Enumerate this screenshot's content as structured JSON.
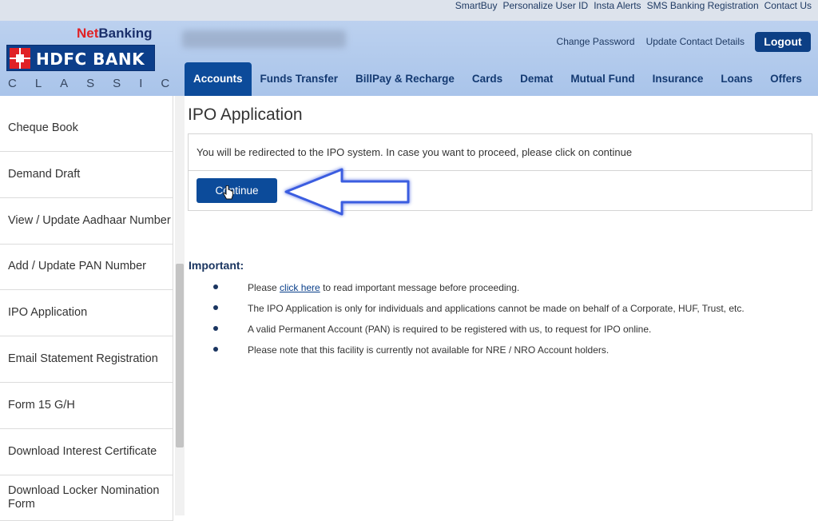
{
  "utility_links": [
    "SmartBuy",
    "Personalize User ID",
    "Insta Alerts",
    "SMS Banking Registration",
    "Contact Us"
  ],
  "logo": {
    "net": "Net",
    "banking": "Banking",
    "bank_name": "HDFC BANK",
    "edition": "CLASSIC"
  },
  "header_links": {
    "change_password": "Change Password",
    "update_contact": "Update Contact Details"
  },
  "logout_label": "Logout",
  "nav_tabs": [
    {
      "label": "Accounts"
    },
    {
      "label": "Funds Transfer"
    },
    {
      "label": "BillPay & Recharge"
    },
    {
      "label": "Cards"
    },
    {
      "label": "Demat"
    },
    {
      "label": "Mutual Fund"
    },
    {
      "label": "Insurance"
    },
    {
      "label": "Loans"
    },
    {
      "label": "Offers"
    }
  ],
  "sidebar_items": [
    "Cheque Book",
    "Demand Draft",
    "View / Update Aadhaar Number",
    "Add / Update PAN Number",
    "IPO Application",
    "Email Statement Registration",
    "Form 15 G/H",
    "Download Interest Certificate",
    "Download Locker Nomination Form"
  ],
  "main": {
    "title": "IPO Application",
    "redirect_message": "You will be redirected to the IPO system. In case you want to proceed, please click on continue",
    "continue_label": "Continue",
    "important_heading": "Important:",
    "note1_prefix": "Please",
    "note1_link": "click here",
    "note1_suffix": "to read important message before proceeding.",
    "note2": "The IPO Application is only for individuals and applications cannot be made on behalf of a Corporate, HUF, Trust, etc.",
    "note3": "A valid Permanent Account (PAN) is required to be registered with us, to request for IPO online.",
    "note4": "Please note that this facility is currently not available for NRE / NRO Account holders."
  },
  "colors": {
    "brand_blue": "#0c4b9a",
    "brand_red": "#e02226",
    "header_bg": "#b5cbec"
  },
  "icons": {
    "arrow": "left-arrow-icon",
    "cursor": "hand-cursor-icon"
  }
}
